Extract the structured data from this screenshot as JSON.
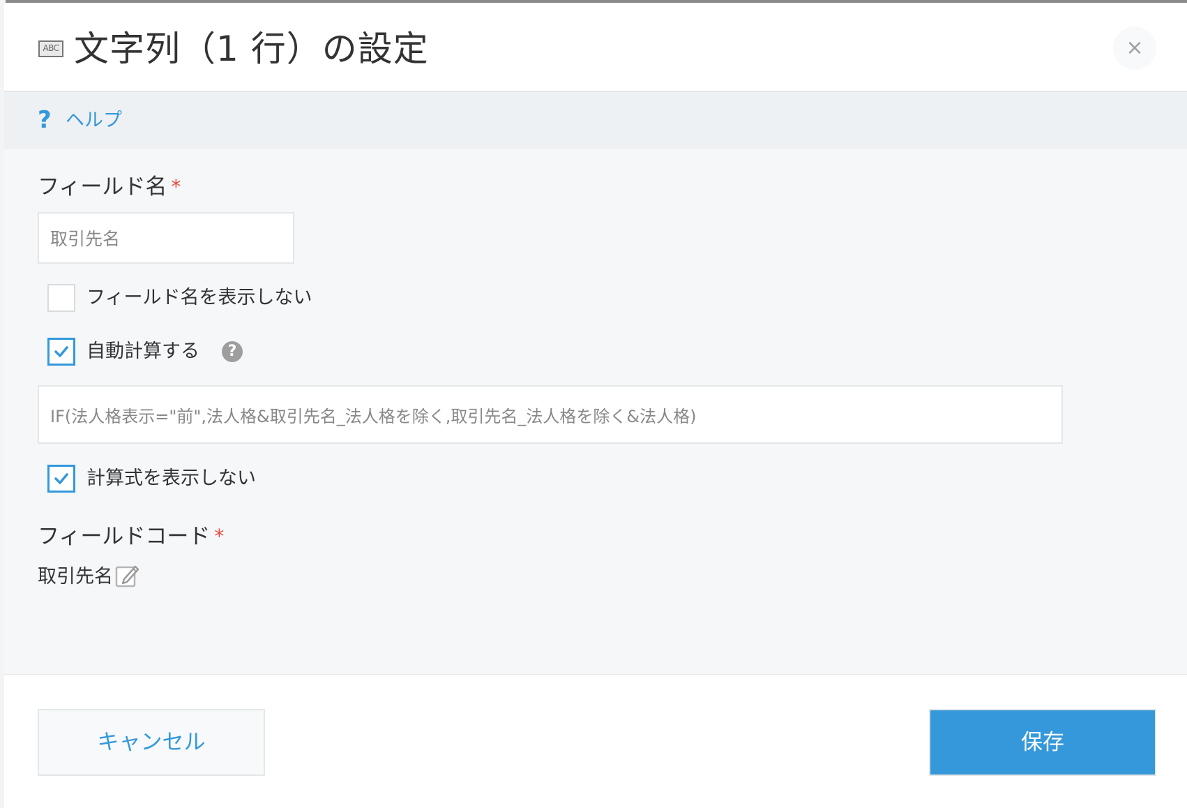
{
  "dialog": {
    "title": "文字列（1 行）の設定",
    "type_icon_text": "ABC",
    "close_label": "×"
  },
  "help": {
    "icon_text": "?",
    "link_label": "ヘルプ"
  },
  "field_name": {
    "label": "フィールド名",
    "required_mark": "*",
    "value": "取引先名"
  },
  "options": {
    "hide_field_name": {
      "label": "フィールド名を表示しない",
      "checked": false
    },
    "auto_calc": {
      "label": "自動計算する",
      "checked": true,
      "help_icon_text": "?"
    },
    "formula": {
      "value": "IF(法人格表示=\"前\",法人格&取引先名_法人格を除く,取引先名_法人格を除く&法人格)"
    },
    "hide_formula": {
      "label": "計算式を表示しない",
      "checked": true
    }
  },
  "field_code": {
    "label": "フィールドコード",
    "required_mark": "*",
    "value": "取引先名"
  },
  "footer": {
    "cancel_label": "キャンセル",
    "save_label": "保存"
  },
  "colors": {
    "accent": "#3498db",
    "required": "#e74c3c",
    "text": "#333333",
    "panel": "#f5f7f9"
  }
}
